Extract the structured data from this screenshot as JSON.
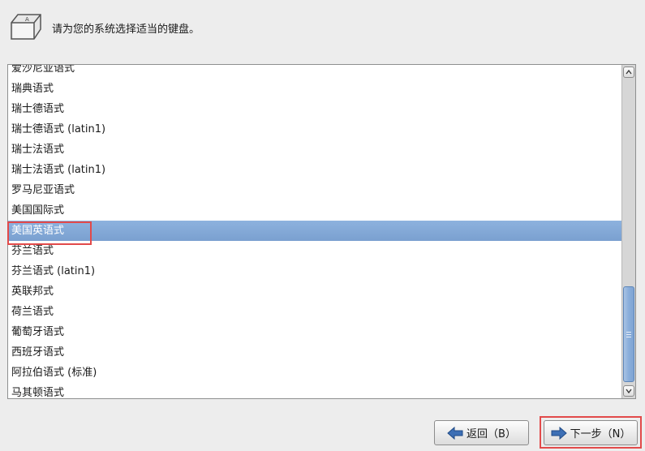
{
  "header": {
    "icon": "keyboard-icon",
    "prompt": "请为您的系统选择适当的键盘。"
  },
  "keyboard_list": {
    "items": [
      "爱沙尼亚语式",
      "瑞典语式",
      "瑞士德语式",
      "瑞士德语式 (latin1)",
      "瑞士法语式",
      "瑞士法语式 (latin1)",
      "罗马尼亚语式",
      "美国国际式",
      "美国英语式",
      "芬兰语式",
      "芬兰语式 (latin1)",
      "英联邦式",
      "荷兰语式",
      "葡萄牙语式",
      "西班牙语式",
      "阿拉伯语式 (标准)",
      "马其顿语式"
    ],
    "selected": "美国英语式"
  },
  "buttons": {
    "back_label": "返回（B）",
    "next_label": "下一步（N）",
    "back_icon": "arrow-left-icon",
    "next_icon": "arrow-right-icon"
  },
  "colors": {
    "selection": "#86abd9",
    "annotation": "#e24a4a",
    "arrow": "#3d6fb5"
  }
}
